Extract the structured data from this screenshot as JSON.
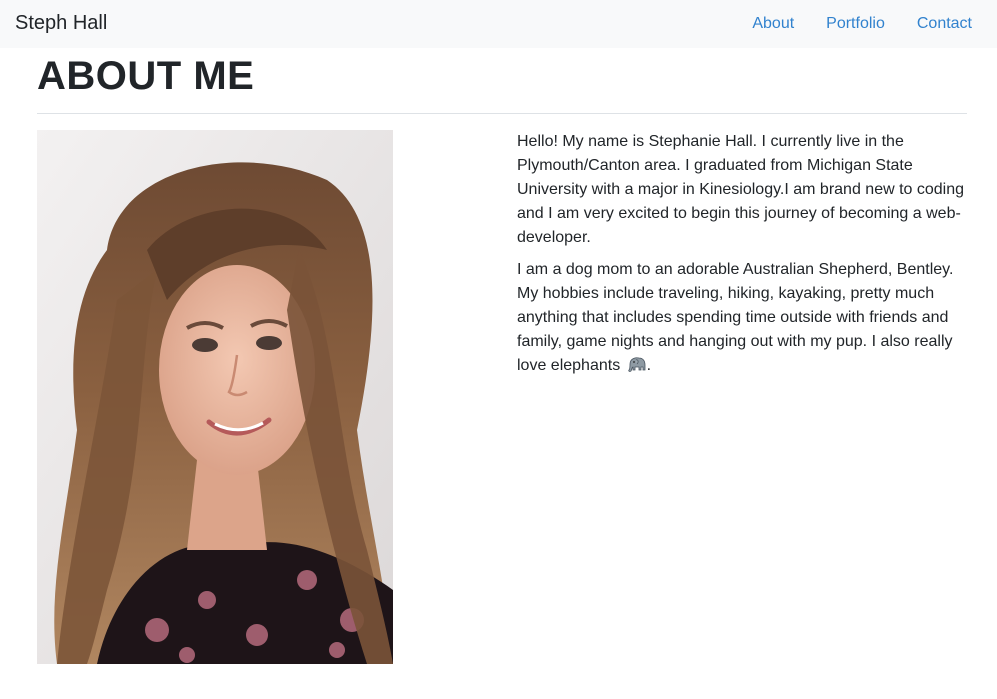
{
  "navbar": {
    "brand": "Steph Hall",
    "links": [
      "About",
      "Portfolio",
      "Contact"
    ],
    "link_color": "#3182ce",
    "background": "#f8f9fa"
  },
  "main": {
    "title": "ABOUT ME",
    "bio": {
      "paragraph1": "Hello! My name is Stephanie Hall. I currently live in the Plymouth/Canton area. I graduated from Michigan State University with a major in Kinesiology.I am brand new to coding and I am very excited to begin this journey of becoming a web-developer.",
      "paragraph2": "I am a dog mom to an adorable Australian Shepherd, Bentley. My hobbies include traveling, hiking, kayaking, pretty much anything that includes spending time outside with friends and family, game nights and hanging out with my pup. I also really love elephants",
      "paragraph2_end": ".",
      "emoji_icon": "elephant-icon"
    }
  }
}
